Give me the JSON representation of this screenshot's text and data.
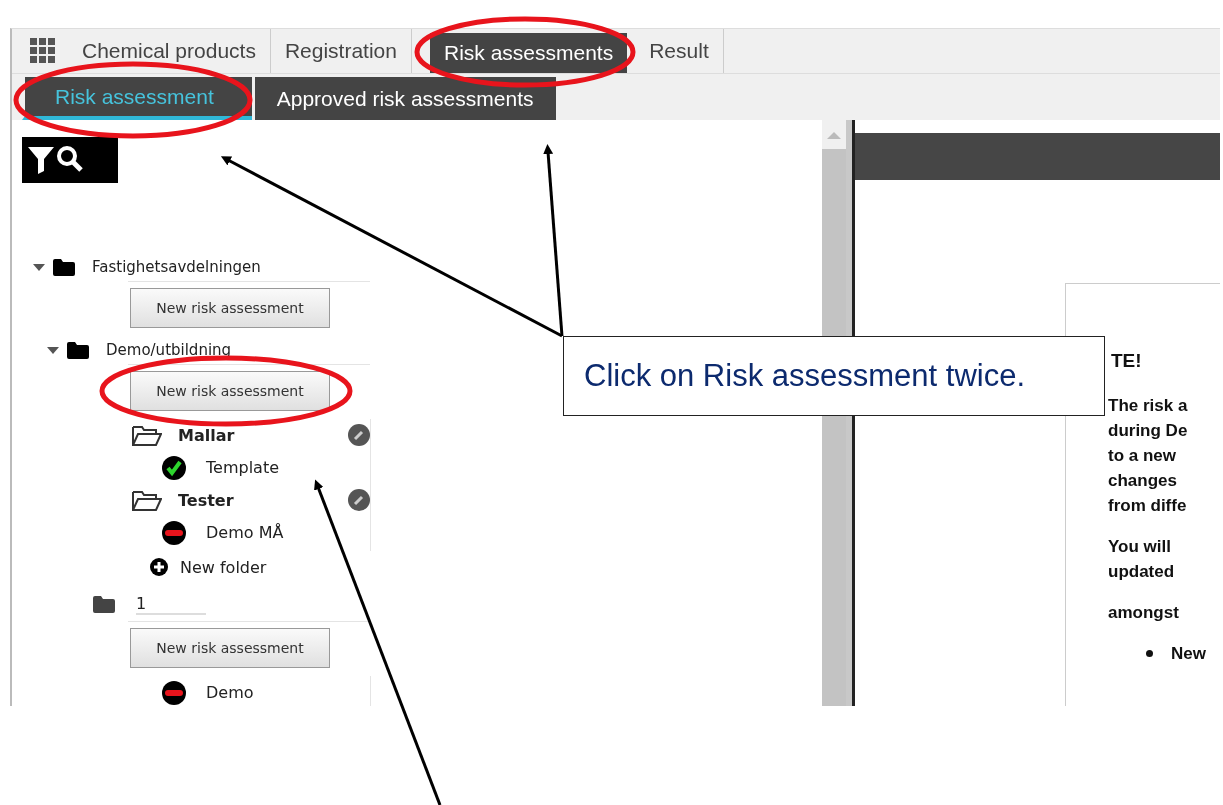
{
  "tabs": [
    {
      "label": "Chemical products",
      "selected": false
    },
    {
      "label": "Registration",
      "selected": false
    },
    {
      "label": "Risk assessments",
      "selected": true
    },
    {
      "label": "Result",
      "selected": false
    }
  ],
  "subtabs": [
    {
      "label": "Risk assessment",
      "selected": true
    },
    {
      "label": "Approved risk assessments",
      "selected": false
    }
  ],
  "tree": [
    {
      "kind": "department",
      "label": "Fastighetsavdelningen",
      "expanded": true,
      "button": "New risk assessment",
      "children": [
        {
          "kind": "department",
          "label": "Demo/utbildning",
          "expanded": true,
          "button": "New risk assessment",
          "new_folder": "New folder",
          "children": [
            {
              "kind": "folder",
              "label": "Mallar",
              "children": [
                {
                  "kind": "assessment",
                  "approved": true,
                  "label": "Template"
                }
              ]
            },
            {
              "kind": "folder",
              "label": "Tester",
              "children": [
                {
                  "kind": "assessment",
                  "approved": false,
                  "label": "Demo MÅ"
                }
              ]
            }
          ]
        },
        {
          "kind": "group",
          "label": "1",
          "button": "New risk assessment",
          "children": [
            {
              "kind": "assessment",
              "approved": false,
              "label": "Demo"
            }
          ]
        }
      ]
    }
  ],
  "notice": {
    "heading": "TE!",
    "paragraphs": [
      [
        "The risk a",
        "during De",
        "to a new",
        "changes",
        "from diffe"
      ],
      [
        "You will",
        "updated"
      ],
      [
        "amongst"
      ]
    ],
    "bullets": [
      "New"
    ]
  },
  "callout": "Click on Risk assessment twice."
}
